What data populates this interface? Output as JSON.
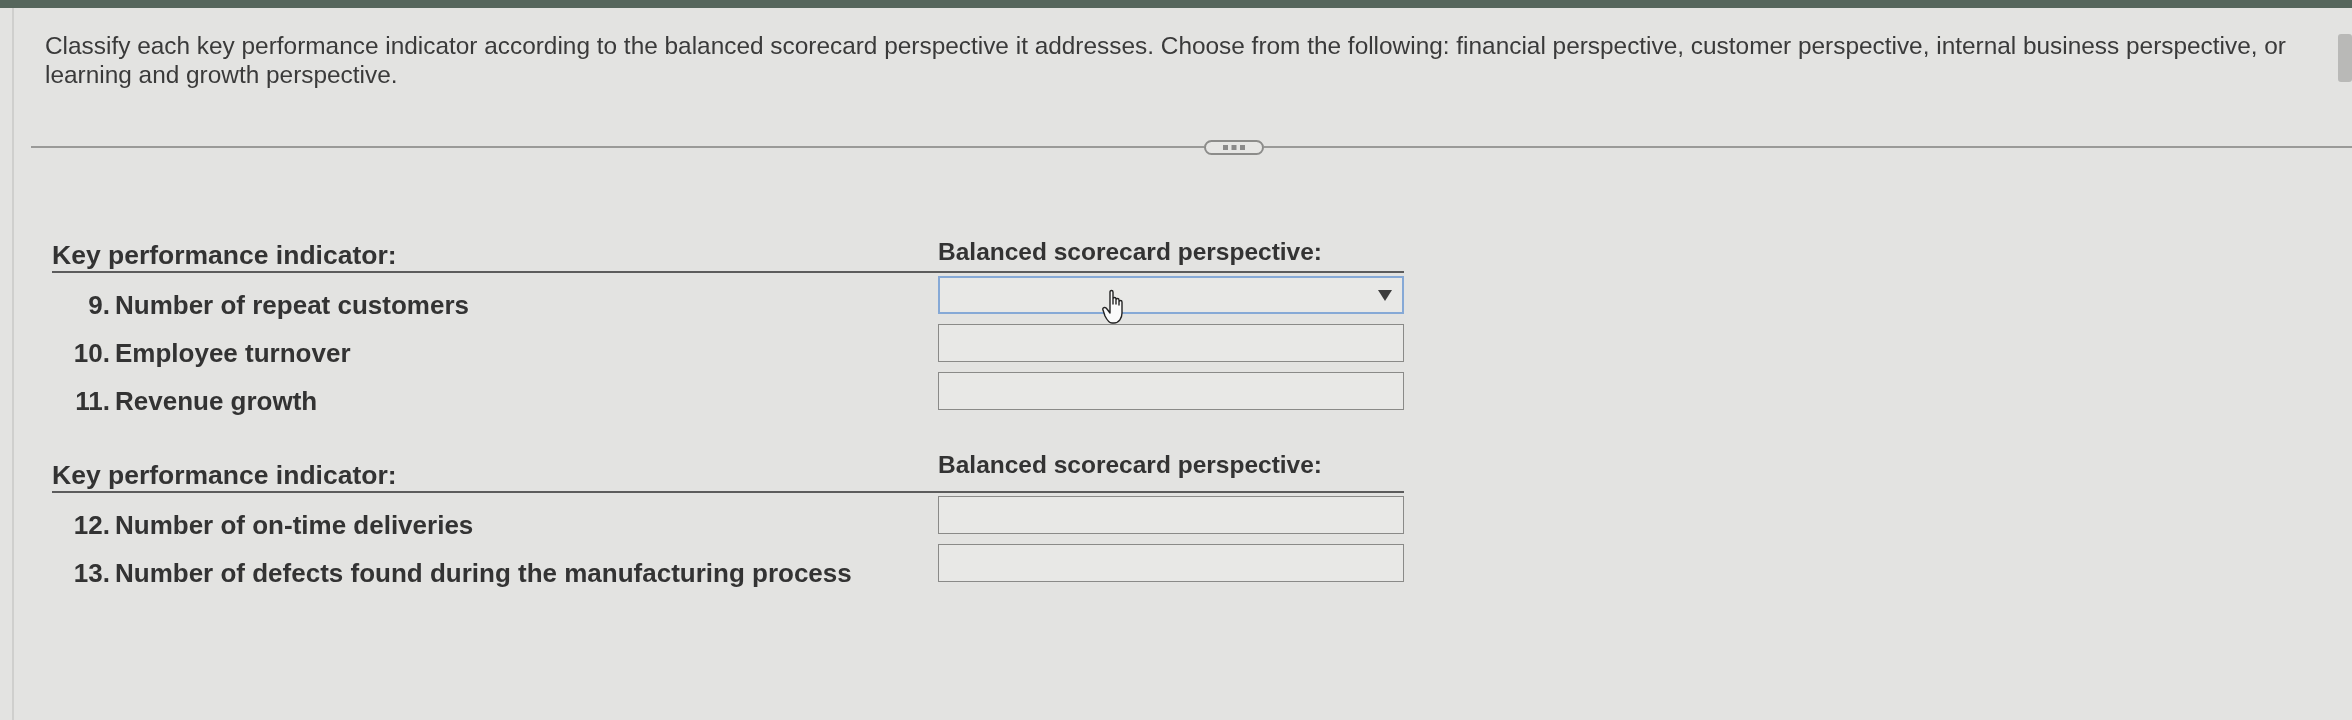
{
  "instructions": "Classify each key performance indicator according to the balanced scorecard perspective it addresses. Choose from the following: financial perspective, customer perspective, internal business perspective, or learning and growth perspective.",
  "sections": [
    {
      "kpi_heading": "Key performance indicator:",
      "perspective_heading": "Balanced scorecard perspective:",
      "items": [
        {
          "number": "9.",
          "indicator": "Number of repeat customers",
          "answer": {
            "hovered": true
          }
        },
        {
          "number": "10.",
          "indicator": "Employee turnover",
          "answer": {
            "hovered": false
          }
        },
        {
          "number": "11.",
          "indicator": "Revenue growth",
          "answer": {
            "hovered": false
          }
        }
      ]
    },
    {
      "kpi_heading": "Key performance indicator:",
      "perspective_heading": "Balanced scorecard perspective:",
      "items": [
        {
          "number": "12.",
          "indicator": "Number of on-time deliveries",
          "answer": {
            "hovered": false
          }
        },
        {
          "number": "13.",
          "indicator": "Number of defects found during the manufacturing process",
          "answer": {
            "hovered": false
          }
        }
      ]
    }
  ]
}
